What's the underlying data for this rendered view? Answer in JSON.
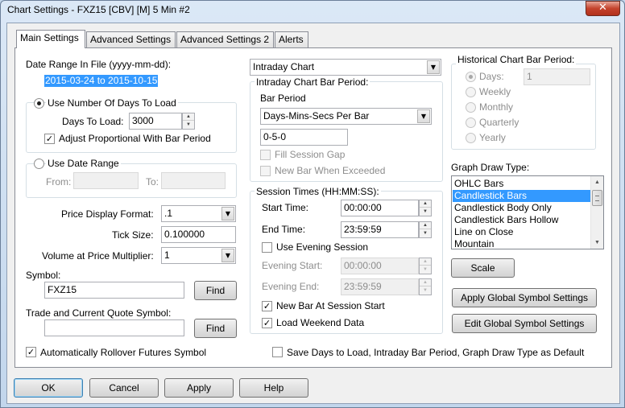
{
  "window": {
    "title": "Chart Settings - FXZ15 [CBV] [M]  5 Min  #2",
    "close_glyph": "✕"
  },
  "tabs": [
    "Main Settings",
    "Advanced Settings",
    "Advanced Settings 2",
    "Alerts"
  ],
  "date_range": {
    "label": "Date Range In File (yyyy-mm-dd):",
    "value": "2015-03-24 to 2015-10-15"
  },
  "days_group": {
    "radio_label": "Use Number Of Days To Load",
    "days_label": "Days To Load:",
    "days_value": "3000",
    "adjust_label": "Adjust Proportional With Bar Period"
  },
  "date_group": {
    "radio_label": "Use Date Range",
    "from_label": "From:",
    "to_label": "To:"
  },
  "price_format": {
    "label": "Price Display Format:",
    "value": ".1"
  },
  "tick_size": {
    "label": "Tick Size:",
    "value": "0.100000"
  },
  "volume_multiplier": {
    "label": "Volume at Price Multiplier:",
    "value": "1"
  },
  "symbol": {
    "label": "Symbol:",
    "value": "FXZ15",
    "find_label": "Find"
  },
  "trade_symbol": {
    "label": "Trade and Current Quote Symbol:",
    "value": "",
    "find_label": "Find"
  },
  "rollover_label": "Automatically Rollover Futures Symbol",
  "chart_type": {
    "value": "Intraday Chart"
  },
  "intraday_period": {
    "group_label": "Intraday Chart Bar Period:",
    "bar_period_label": "Bar Period",
    "bar_period_value": "Days-Mins-Secs Per Bar",
    "period_value": "0-5-0",
    "fill_gap_label": "Fill Session Gap",
    "new_bar_label": "New Bar When Exceeded"
  },
  "session_times": {
    "group_label": "Session Times (HH:MM:SS):",
    "start_label": "Start Time:",
    "start_value": "00:00:00",
    "end_label": "End Time:",
    "end_value": "23:59:59",
    "evening_label": "Use Evening Session",
    "evening_start_label": "Evening Start:",
    "evening_start_value": "00:00:00",
    "evening_end_label": "Evening End:",
    "evening_end_value": "23:59:59",
    "new_bar_session_label": "New Bar At Session Start",
    "weekend_label": "Load Weekend Data"
  },
  "historical_period": {
    "group_label": "Historical Chart Bar Period:",
    "options": [
      "Days:",
      "Weekly",
      "Monthly",
      "Quarterly",
      "Yearly"
    ],
    "days_value": "1"
  },
  "graph_draw": {
    "label": "Graph Draw Type:",
    "items": [
      "OHLC Bars",
      "Candlestick Bars",
      "Candlestick Body Only",
      "Candlestick Bars Hollow",
      "Line on Close",
      "Mountain"
    ],
    "selected_index": 1,
    "scale_label": "Scale"
  },
  "global_buttons": {
    "apply": "Apply Global Symbol Settings",
    "edit": "Edit Global Symbol Settings"
  },
  "save_default_label": "Save Days to Load, Intraday Bar Period, Graph Draw Type as Default",
  "footer": {
    "ok": "OK",
    "cancel": "Cancel",
    "apply": "Apply",
    "help": "Help"
  },
  "glyphs": {
    "check": "✓",
    "dropdown": "▼",
    "up": "▲",
    "down": "▼"
  }
}
